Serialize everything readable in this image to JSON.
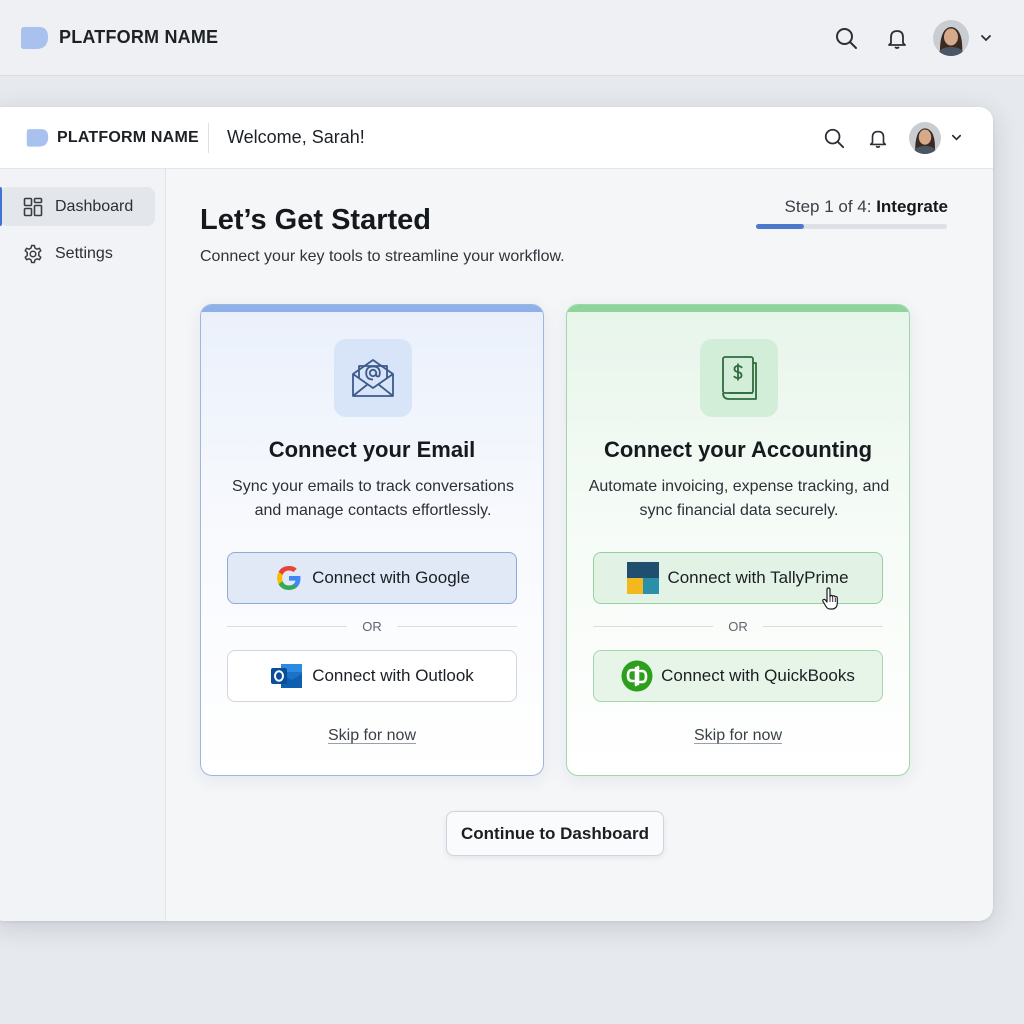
{
  "outer_bar": {
    "brand": "PLATFORM NAME",
    "icons": [
      "logo-icon",
      "search-icon",
      "bell-icon",
      "avatar",
      "chevron-down-icon"
    ]
  },
  "header": {
    "brand": "PLATFORM NAME",
    "welcome": "Welcome, Sarah!",
    "icons": [
      "logo-icon",
      "search-icon",
      "bell-icon",
      "avatar",
      "chevron-down-icon"
    ]
  },
  "sidebar": {
    "items": [
      {
        "label": "Dashboard",
        "icon": "grid-icon",
        "active": true
      },
      {
        "label": "Settings",
        "icon": "gear-icon",
        "active": false
      }
    ]
  },
  "main": {
    "title": "Let’s Get Started",
    "subtitle": "Connect your key tools to streamline your workflow.",
    "step": {
      "prefix": "Step 1 of 4: ",
      "current": "Integrate",
      "progress": 0.25
    }
  },
  "cards": {
    "email": {
      "icon": "email-at-icon",
      "title": "Connect your Email",
      "description": "Sync your emails to track conversations and manage contacts effortlessly.",
      "primary": {
        "label": "Connect with Google",
        "icon": "google-icon"
      },
      "or": "OR",
      "secondary": {
        "label": "Connect with Outlook",
        "icon": "outlook-icon"
      },
      "skip": "Skip for now"
    },
    "accounting": {
      "icon": "ledger-dollar-icon",
      "title": "Connect your Accounting",
      "description": "Automate invoicing, expense tracking, and sync financial data securely.",
      "primary": {
        "label": "Connect with TallyPrime",
        "icon": "tallyprime-icon"
      },
      "or": "OR",
      "secondary": {
        "label": "Connect with QuickBooks",
        "icon": "quickbooks-icon"
      },
      "skip": "Skip for now"
    }
  },
  "footer": {
    "continue": "Continue to Dashboard"
  },
  "colors": {
    "accent_blue": "#4d79cc",
    "email_border": "#9fb6e3",
    "accounting_border": "#9fd7a8",
    "background": "#e6e9ed"
  }
}
